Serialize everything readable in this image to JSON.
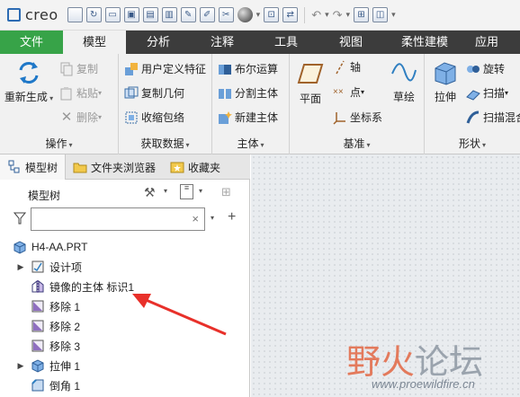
{
  "app": {
    "logo_text": "creo"
  },
  "tabs": [
    "文件",
    "模型",
    "分析",
    "注释",
    "工具",
    "视图",
    "柔性建模",
    "应用"
  ],
  "ribbon": {
    "operations": {
      "regenerate": "重新生成",
      "copy": "复制",
      "paste": "粘贴",
      "delete": "删除",
      "label": "操作"
    },
    "get_data": {
      "udf": "用户定义特征",
      "copy_geom": "复制几何",
      "shrinkwrap": "收缩包络",
      "label": "获取数据"
    },
    "body": {
      "boolean": "布尔运算",
      "split": "分割主体",
      "new_body": "新建主体",
      "label": "主体"
    },
    "datum": {
      "plane": "平面",
      "axis": "轴",
      "point": "点",
      "csys": "坐标系",
      "sketch": "草绘",
      "label": "基准"
    },
    "shapes": {
      "extrude": "拉伸",
      "revolve": "旋转",
      "sweep": "扫描",
      "swept_blend": "扫描混合",
      "label": "形状"
    }
  },
  "left_pane": {
    "tabs": [
      "模型树",
      "文件夹浏览器",
      "收藏夹"
    ],
    "tree_title": "模型树",
    "search": {
      "value": ""
    },
    "nodes": [
      "H4-AA.PRT",
      "设计项",
      "镜像的主体 标识1",
      "移除 1",
      "移除 2",
      "移除 3",
      "拉伸 1",
      "倒角 1"
    ]
  },
  "watermark": {
    "text_a": "野火",
    "text_b": "论坛",
    "url": "www.proewildfire.cn"
  },
  "colors": {
    "accent_green": "#37a348",
    "tab_bar": "#3c3c3c",
    "arrow": "#e8302a"
  }
}
